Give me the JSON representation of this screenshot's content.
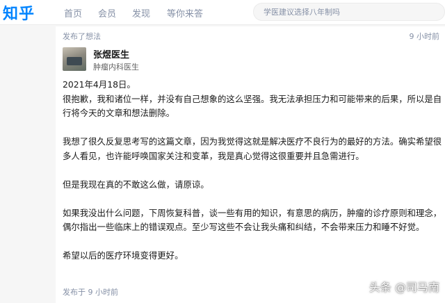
{
  "header": {
    "logo": "知乎",
    "nav": [
      "首页",
      "会员",
      "发现",
      "等你来答"
    ],
    "search_placeholder": "学医建议选择八年制吗"
  },
  "post": {
    "posted_label": "发布了想法",
    "time_top": "9 小时前",
    "author_name": "张煜医生",
    "author_title": "肿瘤内科医生",
    "paragraphs": [
      "2021年4月18日。",
      "很抱歉，我和诸位一样，并没有自己想象的这么坚强。我无法承担压力和可能带来的后果，所以是自行将今天的文章和想法删除。",
      "我想了很久反复思考写的这篇文章，因为我觉得这就是解决医疗不良行为的最好的方法。确实希望很多人看见，也许能呼唤国家关注和变革，我是真心觉得这很重要并且急需进行。",
      "但是我现在真的不敢这么做，请原谅。",
      "如果我没出什么问题，下周恢复科普，谈一些有用的知识，有意思的病历，肿瘤的诊疗原则和理念，偶尔指出一些临床上的错误观点。至少写这些不会让我头痛和纠结，不会带来压力和睡不好觉。",
      "希望以后的医疗环境变得更好。"
    ],
    "posted_bottom": "发布于 9 小时前"
  },
  "watermark": "头条 @司马南",
  "colors": {
    "brand": "#0084ff",
    "muted": "#8590a6"
  }
}
